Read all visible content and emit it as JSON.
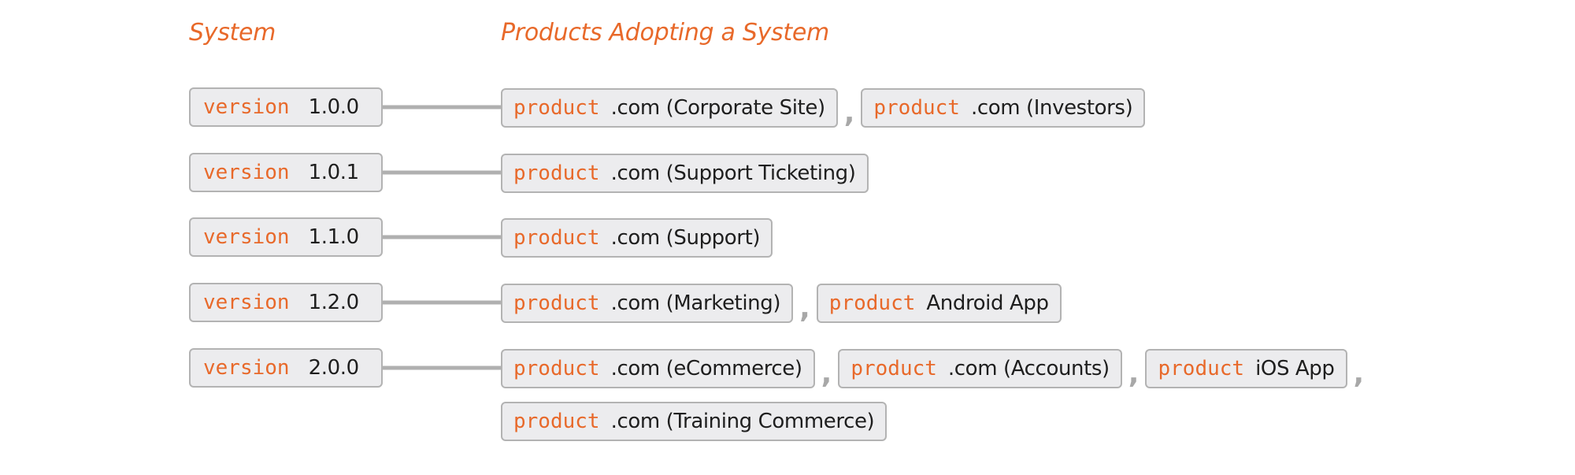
{
  "headings": {
    "system": "System",
    "products": "Products Adopting a System"
  },
  "colors": {
    "accent": "#e8692a",
    "pill_bg": "#ececee",
    "pill_border": "#b3b3b3",
    "connector": "#b0b0b0",
    "text": "#1e1e1e"
  },
  "keyword_version": "version",
  "keyword_product": "product",
  "separator": ",",
  "rows": [
    {
      "version": "1.0.0",
      "products": [
        [
          ".com (Corporate Site)",
          ".com (Investors)"
        ]
      ]
    },
    {
      "version": "1.0.1",
      "products": [
        [
          ".com (Support Ticketing)"
        ]
      ]
    },
    {
      "version": "1.1.0",
      "products": [
        [
          ".com (Support)"
        ]
      ]
    },
    {
      "version": "1.2.0",
      "products": [
        [
          ".com (Marketing)",
          "Android App"
        ]
      ]
    },
    {
      "version": "2.0.0",
      "products": [
        [
          ".com (eCommerce)",
          ".com (Accounts)",
          "iOS App"
        ],
        [
          ".com (Training Commerce)"
        ]
      ],
      "trailing_separator_on_line": [
        true,
        false
      ]
    }
  ]
}
